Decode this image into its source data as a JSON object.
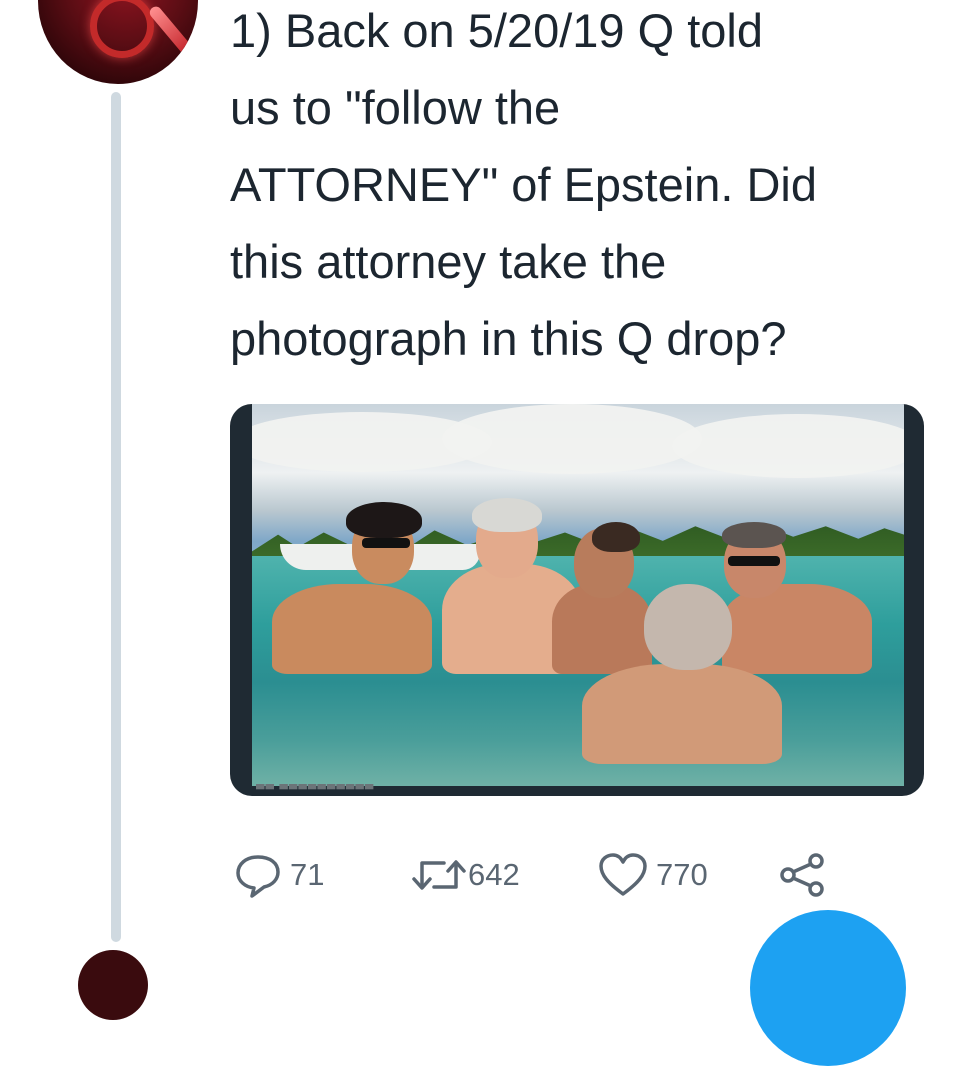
{
  "tweet": {
    "lines": [
      "1) Back on 5/20/19 Q told",
      "us to \"follow the",
      "ATTORNEY\" of Epstein. Did",
      "this attorney take the",
      "photograph in this Q drop?"
    ]
  },
  "actions": {
    "replies": "71",
    "retweets": "642",
    "likes": "770"
  },
  "icons": {
    "reply": "reply-icon",
    "retweet": "retweet-icon",
    "like": "heart-icon",
    "share": "share-icon"
  },
  "colors": {
    "text": "#1c2630",
    "icon": "#5a6672",
    "thread_line": "#cfd9e0",
    "fab": "#1da1f2"
  }
}
